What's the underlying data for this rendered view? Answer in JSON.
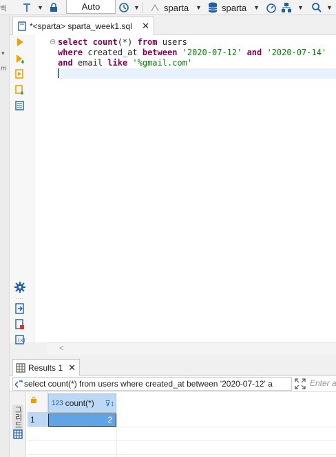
{
  "toolbar": {
    "commit_mode": "Auto",
    "connection": "sparta",
    "database": "sparta",
    "left_clip_text": "백"
  },
  "editor": {
    "tab_title": "*<sparta> sparta_week1.sql",
    "lines": [
      [
        {
          "t": "select ",
          "c": "kw"
        },
        {
          "t": "count",
          "c": "kw"
        },
        {
          "t": "(*) ",
          "c": ""
        },
        {
          "t": "from ",
          "c": "kw"
        },
        {
          "t": "users",
          "c": ""
        }
      ],
      [
        {
          "t": "where ",
          "c": "kw"
        },
        {
          "t": "created_at ",
          "c": ""
        },
        {
          "t": "between ",
          "c": "kw"
        },
        {
          "t": "'2020-07-12'",
          "c": "str"
        },
        {
          "t": " ",
          "c": ""
        },
        {
          "t": "and ",
          "c": "kw"
        },
        {
          "t": "'2020-07-14'",
          "c": "str"
        }
      ],
      [
        {
          "t": "and ",
          "c": "kw"
        },
        {
          "t": "email ",
          "c": ""
        },
        {
          "t": "like ",
          "c": "kw"
        },
        {
          "t": "'%gmail.com'",
          "c": "str"
        }
      ]
    ],
    "hscroll_arrow": "<"
  },
  "results": {
    "tab_label": "Results 1",
    "filter_query": "select count(*) from users where created_at between '2020-07-12' a",
    "filter_placeholder": "Enter a S",
    "column_type": "123",
    "column_name": "count(*)",
    "rows": [
      {
        "num": "1",
        "value": "2"
      }
    ],
    "side_label": "그리드"
  },
  "colors": {
    "accent": "#5fa5e6",
    "keyword": "#7f0055",
    "string": "#008000"
  }
}
